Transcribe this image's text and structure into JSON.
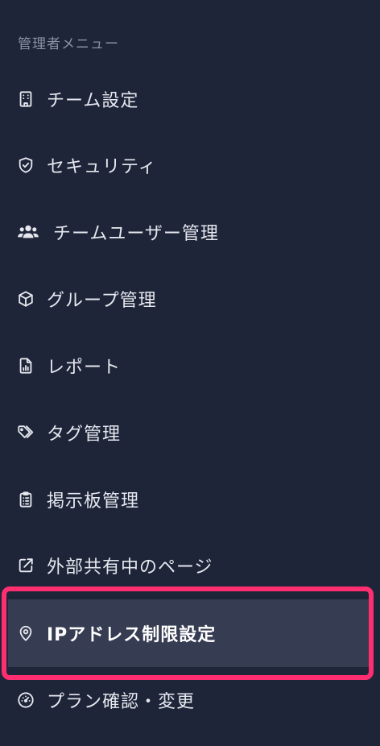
{
  "sidebar": {
    "section_title": "管理者メニュー",
    "items": [
      {
        "label": "チーム設定",
        "icon": "building-icon"
      },
      {
        "label": "セキュリティ",
        "icon": "shield-check-icon"
      },
      {
        "label": "チームユーザー管理",
        "icon": "users-icon"
      },
      {
        "label": "グループ管理",
        "icon": "cube-icon"
      },
      {
        "label": "レポート",
        "icon": "report-file-icon"
      },
      {
        "label": "タグ管理",
        "icon": "tags-icon"
      },
      {
        "label": "掲示板管理",
        "icon": "clipboard-icon"
      },
      {
        "label": "外部共有中のページ",
        "icon": "external-link-icon"
      },
      {
        "label": "IPアドレス制限設定",
        "icon": "map-pin-icon",
        "active": true
      },
      {
        "label": "プラン確認・変更",
        "icon": "gauge-icon"
      }
    ]
  },
  "colors": {
    "background": "#1e2539",
    "active_background": "#363c52",
    "highlight_border": "#ff2e70",
    "text": "#e6e8ee",
    "section_title": "#8b91a3"
  }
}
